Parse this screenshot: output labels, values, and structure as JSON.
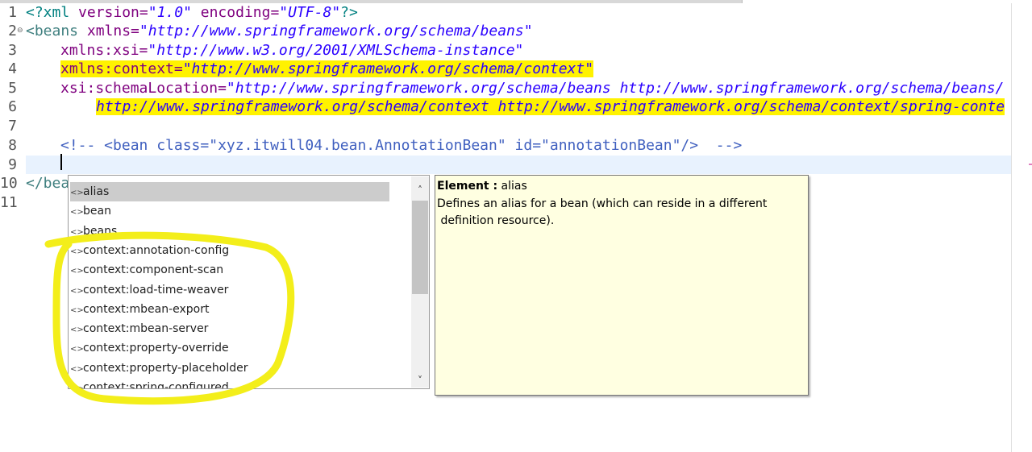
{
  "editor": {
    "line_numbers": [
      "1",
      "2",
      "3",
      "4",
      "5",
      "6",
      "7",
      "8",
      "9",
      "10",
      "11"
    ],
    "fold_marker": "⊖",
    "lines": {
      "l1": {
        "open": "<?xml ",
        "attr1": "version=",
        "val1": "\"1.0\"",
        "attr2": " encoding=",
        "val2": "\"UTF-8\"",
        "close": "?>"
      },
      "l2": {
        "open": "<beans ",
        "attr": "xmlns=",
        "val": "\"http://www.springframework.org/schema/beans\""
      },
      "l3": {
        "attr": "xmlns:xsi=",
        "val": "\"http://www.w3.org/2001/XMLSchema-instance\""
      },
      "l4": {
        "attr": "xmlns:context=",
        "val": "\"http://www.springframework.org/schema/context\""
      },
      "l5": {
        "attr": "xsi:schemaLocation=",
        "val": "\"http://www.springframework.org/schema/beans http://www.springframework.org/schema/beans/"
      },
      "l6": {
        "val": "http://www.springframework.org/schema/context http://www.springframework.org/schema/context/spring-conte"
      },
      "l8": {
        "comment": "<!-- <bean class=\"xyz.itwill04.bean.AnnotationBean\" id=\"annotationBean\"/>  -->"
      },
      "l10": {
        "text": "</bea"
      }
    }
  },
  "completion": {
    "items": [
      "alias",
      "bean",
      "beans",
      "context:annotation-config",
      "context:component-scan",
      "context:load-time-weaver",
      "context:mbean-export",
      "context:mbean-server",
      "context:property-override",
      "context:property-placeholder",
      "context:spring-configured"
    ],
    "selected": "alias",
    "item_icon": "xml-element-icon",
    "icon_glyph": "<>",
    "scroll_up": "˄",
    "scroll_down": "˅"
  },
  "info": {
    "label": "Element :",
    "name": "alias",
    "description": "Defines an alias for a bean (which can reside in a different\n definition resource)."
  },
  "colors": {
    "highlight": "#fff200",
    "annotation": "#f3ee1a",
    "selected_item": "#cccccc",
    "tooltip_bg": "#ffffe1"
  }
}
